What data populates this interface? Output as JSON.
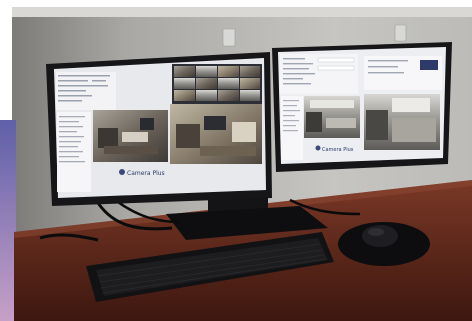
{
  "scene": {
    "kind": "photo",
    "colors": {
      "wall": "#b9b8b4",
      "wall_shadow": "#8d8c88",
      "desk_top": "#6a2f1e",
      "desk_front": "#4a1f14",
      "bezel": "#1a1a1c",
      "screen_ui": "#e9eaee",
      "keyboard": "#151517"
    },
    "left_monitor": {
      "logo_text": "Camera Plus"
    },
    "right_monitor": {
      "logo_text": "Camera Plus"
    }
  }
}
